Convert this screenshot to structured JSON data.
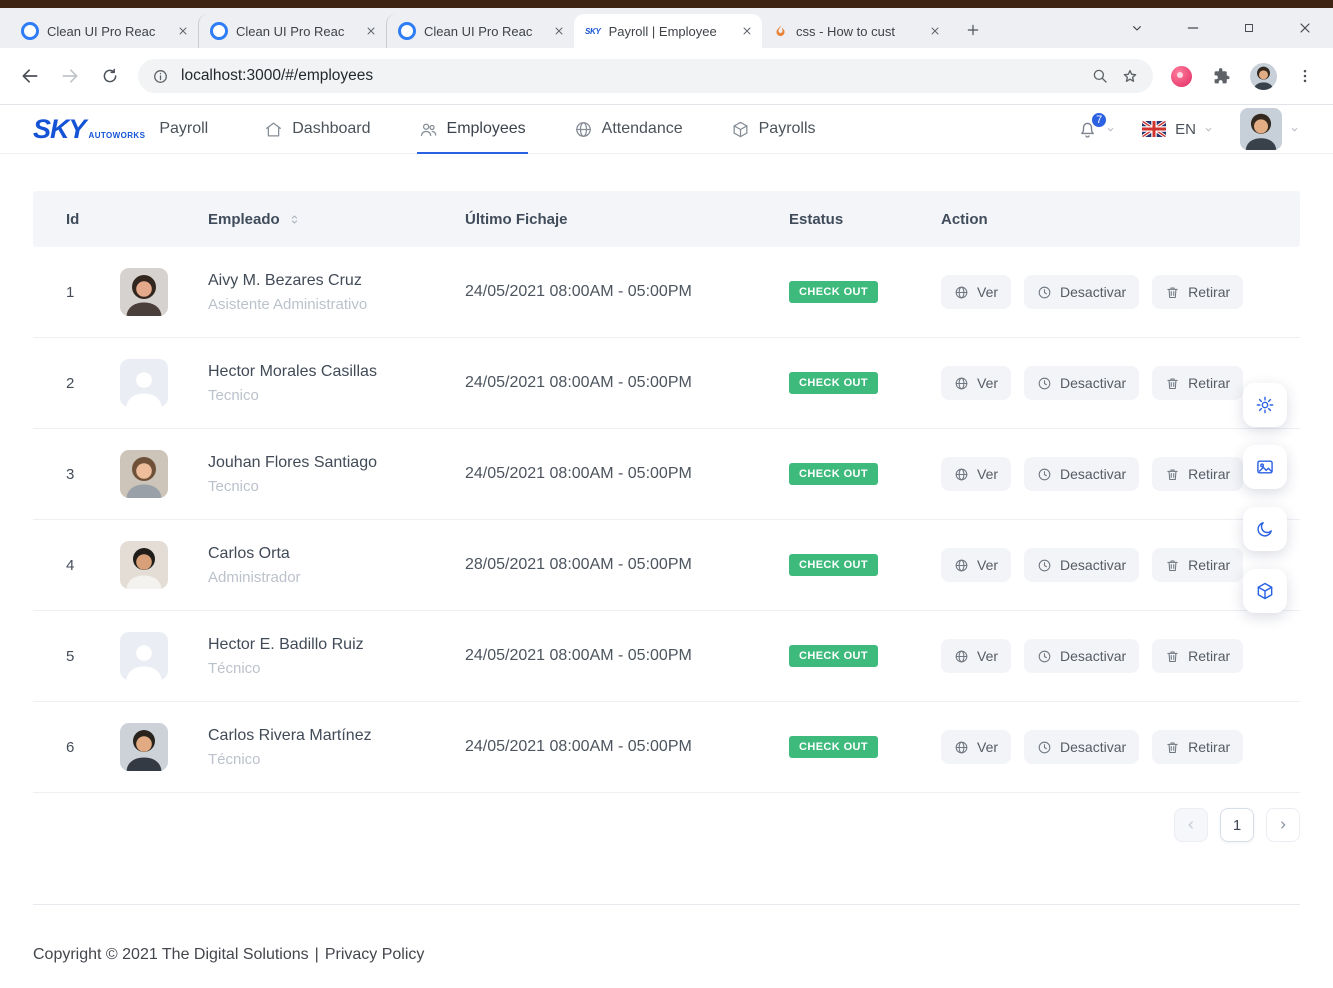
{
  "browser": {
    "tabs": [
      {
        "title": "Clean UI Pro Reac"
      },
      {
        "title": "Clean UI Pro Reac"
      },
      {
        "title": "Clean UI Pro Reac"
      },
      {
        "title": "Payroll | Employee"
      },
      {
        "title": "css - How to cust"
      }
    ],
    "favicons": {
      "sky_label": "SKY"
    },
    "url": "localhost:3000/#/employees"
  },
  "app_header": {
    "logo_main": "SKY",
    "logo_sub": "AUTOWORKS",
    "section": "Payroll",
    "nav": [
      {
        "label": "Dashboard"
      },
      {
        "label": "Employees"
      },
      {
        "label": "Attendance"
      },
      {
        "label": "Payrolls"
      }
    ],
    "notification_count": "7",
    "language": "EN"
  },
  "table": {
    "columns": {
      "id": "Id",
      "employee": "Empleado",
      "last_check": "Último Fichaje",
      "status": "Estatus",
      "action": "Action"
    },
    "actions": {
      "view": "Ver",
      "deactivate": "Desactivar",
      "remove": "Retirar"
    },
    "rows": [
      {
        "id": "1",
        "name": "Aivy M. Bezares Cruz",
        "role": "Asistente Administrativo",
        "time": "24/05/2021 08:00AM - 05:00PM",
        "status": "CHECK OUT",
        "avatar": "photo-f1"
      },
      {
        "id": "2",
        "name": "Hector Morales Casillas",
        "role": "Tecnico",
        "time": "24/05/2021 08:00AM - 05:00PM",
        "status": "CHECK OUT",
        "avatar": "placeholder"
      },
      {
        "id": "3",
        "name": "Jouhan Flores Santiago",
        "role": "Tecnico",
        "time": "24/05/2021 08:00AM - 05:00PM",
        "status": "CHECK OUT",
        "avatar": "photo-f2"
      },
      {
        "id": "4",
        "name": "Carlos Orta",
        "role": "Administrador",
        "time": "28/05/2021 08:00AM - 05:00PM",
        "status": "CHECK OUT",
        "avatar": "photo-m1"
      },
      {
        "id": "5",
        "name": "Hector E. Badillo Ruiz",
        "role": "Técnico",
        "time": "24/05/2021 08:00AM - 05:00PM",
        "status": "CHECK OUT",
        "avatar": "placeholder"
      },
      {
        "id": "6",
        "name": "Carlos Rivera Martínez",
        "role": "Técnico",
        "time": "24/05/2021 08:00AM - 05:00PM",
        "status": "CHECK OUT",
        "avatar": "photo-m2"
      }
    ],
    "pagination": {
      "page": "1"
    }
  },
  "footer": {
    "copyright": "Copyright © 2021 The Digital Solutions",
    "separator": "|",
    "privacy": "Privacy Policy"
  },
  "colors": {
    "accent": "#2b62e3",
    "success": "#3fba7d",
    "logo_blue": "#1453d6"
  }
}
